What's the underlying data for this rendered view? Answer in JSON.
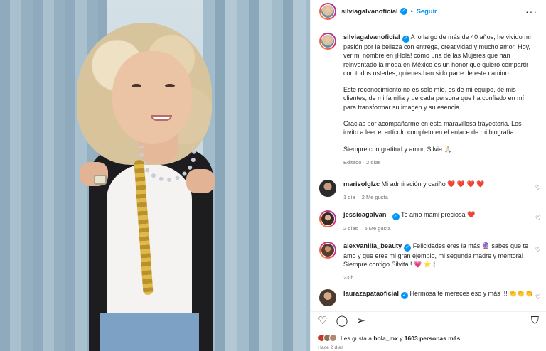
{
  "post": {
    "username": "silviagalvanoficial",
    "follow_label": "Seguir",
    "more_icon": "more-horizontal-icon",
    "caption_paragraphs": [
      "A lo largo de más de 40 años, he vivido mi pasión por la belleza con entrega, creatividad y mucho amor. Hoy, ver mi nombre en ¡Hola! como una de las Mujeres que han reinventado la moda en México es un honor que quiero compartir con todos ustedes, quienes han sido parte de este camino.",
      "Este reconocimiento no es solo mío, es de mi equipo, de mis clientes, de mi familia y de cada persona que ha confiado en mí para transformar su imagen y su esencia.",
      "Gracias por acompañarme en esta maravillosa trayectoria. Los invito a leer el artículo completo en el enlace de mi biografía.",
      "Siempre con gratitud y amor, Silvia 🙏🏻"
    ],
    "caption_meta": "Editado · 2 días"
  },
  "comments": [
    {
      "user": "marisolglzc",
      "verified": false,
      "text": "Mi admiración y cariño",
      "emoji": "❤️ ❤️ ❤️ ❤️",
      "time": "1 día",
      "likes": "2 Me gusta"
    },
    {
      "user": "jessicagalvan_",
      "verified": true,
      "text": "Te amo mami preciosa",
      "emoji": "❤️",
      "time": "2 días",
      "likes": "5 Me gusta"
    },
    {
      "user": "alexvanilla_beauty",
      "verified": true,
      "text": "Felicidades eres la más 🔮 sabes que te amo y que eres mi gran ejemplo, mi segunda madre y mentora! Siempre contigo Silvita ! 💗 ⭐ 🕯",
      "emoji": "",
      "time": "23 h",
      "likes": ""
    },
    {
      "user": "laurazapataoficial",
      "verified": true,
      "text": "Hermosa te mereces eso y más !!!",
      "emoji": "👏👏👏",
      "time": "",
      "likes": ""
    }
  ],
  "actions": {
    "like_icon": "heart-icon",
    "comment_icon": "comment-icon",
    "share_icon": "send-icon",
    "save_icon": "bookmark-icon"
  },
  "likes": {
    "prefix": "Les gusta a ",
    "user": "hola_mx",
    "middle": " y ",
    "count": "1603 personas más"
  },
  "posted": "Hace 2 días",
  "colors": {
    "accent": "#0095f6",
    "muted": "#737373",
    "heart": "#ed4956"
  }
}
